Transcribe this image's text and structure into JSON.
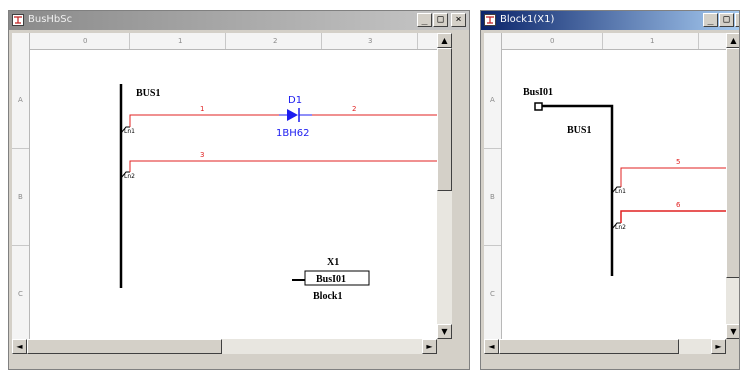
{
  "windows": [
    {
      "title": "BusHbSc",
      "columns": [
        "0",
        "1",
        "2",
        "3"
      ],
      "rows": [
        "A",
        "B",
        "C"
      ],
      "schematic": {
        "bus_label": "BUS1",
        "net1_label": "Ln1",
        "net2_label": "Ln2",
        "wire1_num": "1",
        "wire2_num": "2",
        "wire3_num": "3",
        "diode_ref": "D1",
        "diode_value": "1BH62",
        "block_ref": "X1",
        "block_port": "BusI01",
        "block_name": "Block1"
      }
    },
    {
      "title": "Block1(X1)",
      "columns": [
        "0",
        "1"
      ],
      "rows": [
        "A",
        "B",
        "C"
      ],
      "schematic": {
        "port_label": "BusI01",
        "bus_label": "BUS1",
        "net1_label": "Ln1",
        "net2_label": "Ln2",
        "wire5_num": "5",
        "wire6_num": "6"
      }
    }
  ],
  "colors": {
    "wire_red": "#e02020",
    "component_blue": "#1c1cf0",
    "bus_black": "#000000",
    "active_title": "#0a246a"
  },
  "title_buttons": {
    "minimize": "_",
    "maximize": "□",
    "close": "×"
  },
  "scroll_arrows": {
    "up": "▲",
    "down": "▼",
    "left": "◄",
    "right": "►"
  }
}
